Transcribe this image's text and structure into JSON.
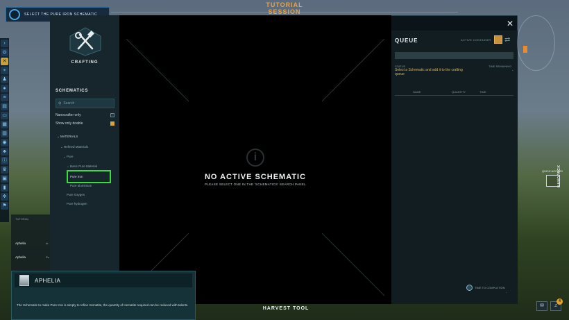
{
  "hud": {
    "objective": "SELECT THE PURE IRON SCHEMATIC",
    "tutorial_title_line1": "TUTORIAL",
    "tutorial_title_line2": "SESSION",
    "harvest_tool": "HARVEST TOOL",
    "quick_access": "QUICK ACCESS",
    "nanopack": "NANOPACK",
    "notification_count": "4"
  },
  "sidebar_icons": [
    "chevron-right-icon",
    "globe-icon",
    "crafting-icon",
    "map-icon",
    "user-icon",
    "coin-icon",
    "list-icon",
    "chart-icon",
    "chat-icon",
    "building-icon",
    "factory-icon",
    "planet-icon",
    "group-icon",
    "info-icon",
    "trophy-icon",
    "camera-icon",
    "lock-icon",
    "settings-icon",
    "flag-icon"
  ],
  "crafting": {
    "label": "CRAFTING",
    "schematics_title": "SCHEMATICS",
    "search_placeholder": "Search",
    "options": [
      {
        "label": "Nanocrafter only",
        "checked": false
      },
      {
        "label": "Show only doable",
        "checked": true
      }
    ],
    "tree": [
      {
        "label": "MATERIALS",
        "level": 0,
        "expanded": true
      },
      {
        "label": "Refined Materials",
        "level": 1,
        "expanded": true
      },
      {
        "label": "Pure",
        "level": 2,
        "expanded": true
      },
      {
        "label": "Basic Pure Material",
        "level": 3,
        "expanded": true
      },
      {
        "label": "Pure Iron",
        "level": 4,
        "selected": true
      },
      {
        "label": "Pure aluminium",
        "level": 4
      },
      {
        "label": "Pure Oxygen",
        "level": 3
      },
      {
        "label": "Pure hydrogen",
        "level": 3
      }
    ]
  },
  "center": {
    "title": "NO ACTIVE SCHEMATIC",
    "subtitle": "PLEASE SELECT ONE IN THE 'SCHEMATICS' SEARCH PANEL"
  },
  "queue": {
    "title": "QUEUE",
    "active_container": "ACTIVE CONTAINER",
    "status_label": "STATUS",
    "status_value": "Select a Schematic and add it to the crafting queue",
    "time_remaining_label": "TIME REMAINING",
    "time_remaining_value": "-",
    "columns": [
      "NAME",
      "QUANTITY",
      "TIME"
    ],
    "time_to_completion": "TIME TO COMPLETION",
    "time_to_completion_value": "-"
  },
  "chat": {
    "tab_label": "TUTORIAL",
    "messages": [
      {
        "name": "Aphelia",
        "snippet": "In"
      },
      {
        "name": "Aphelia",
        "snippet": "Pu"
      }
    ]
  },
  "dialog": {
    "speaker": "APHELIA",
    "text": "The Schematic to make Pure Iron is simply to refine Hematite, the quantity of Hematite required can be reduced with talents."
  }
}
